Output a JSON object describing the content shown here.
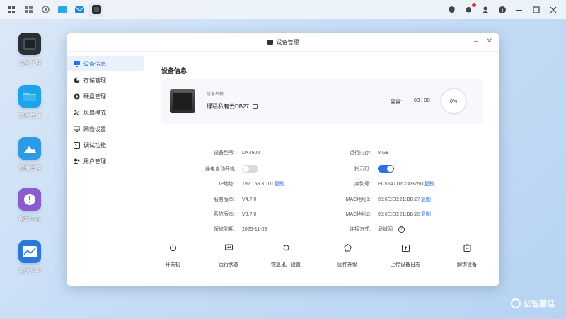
{
  "taskbar": {
    "notification_badge": "1"
  },
  "desktop": {
    "icons": [
      {
        "label": "设备管理",
        "color": "#2a2e35"
      },
      {
        "label": "文件管理",
        "color": "#1fa3e8"
      },
      {
        "label": "相册管理",
        "color": "#2b9be6"
      },
      {
        "label": "帮助中心",
        "color": "#8b5ccf"
      },
      {
        "label": "系统监控",
        "color": "#2a78d8"
      }
    ]
  },
  "window": {
    "title": "设备管理",
    "sidebar": [
      {
        "label": "设备信息",
        "icon": "computer-icon",
        "active": true
      },
      {
        "label": "存储管理",
        "icon": "pie-chart-icon",
        "active": false
      },
      {
        "label": "硬盘管理",
        "icon": "disk-icon",
        "active": false
      },
      {
        "label": "风扇模式",
        "icon": "fan-icon",
        "active": false
      },
      {
        "label": "网络设置",
        "icon": "network-icon",
        "active": false
      },
      {
        "label": "调试功能",
        "icon": "debug-icon",
        "active": false
      },
      {
        "label": "用户管理",
        "icon": "users-icon",
        "active": false
      }
    ],
    "section_title": "设备信息",
    "device": {
      "name_label": "设备名称",
      "name": "绿联私有云DB27",
      "capacity_label": "容量:",
      "capacity_value": "0B / 0B",
      "usage_percent": "0%"
    },
    "info_left": [
      {
        "key": "设备型号:",
        "value": "DX4600"
      },
      {
        "key": "通电自动开机",
        "value": "",
        "toggle": false
      },
      {
        "key": "IP地址:",
        "value": "192.168.3.101",
        "copy": "复制"
      },
      {
        "key": "服务版本:",
        "value": "V4.7.0"
      },
      {
        "key": "系统版本:",
        "value": "V3.7.0"
      },
      {
        "key": "保修到期:",
        "value": "2025-11-09"
      }
    ],
    "info_right": [
      {
        "key": "运行内存:",
        "value": "8 GB"
      },
      {
        "key": "指示灯:",
        "value": "",
        "toggle": true
      },
      {
        "key": "序列号:",
        "value": "EC554JJ16230375D",
        "copy": "复制"
      },
      {
        "key": "MAC地址1:",
        "value": "98:6E:E8:21:DB:27",
        "copy": "复制"
      },
      {
        "key": "MAC地址2:",
        "value": "98:6E:E8:21:DB:28",
        "copy": "复制"
      },
      {
        "key": "连接方式:",
        "value": "局域网"
      }
    ],
    "actions": [
      {
        "label": "开关机",
        "icon": "power-icon"
      },
      {
        "label": "运行状态",
        "icon": "monitor-icon"
      },
      {
        "label": "恢复出厂设置",
        "icon": "reset-icon"
      },
      {
        "label": "固件升级",
        "icon": "upgrade-icon"
      },
      {
        "label": "上传设备日志",
        "icon": "upload-log-icon"
      },
      {
        "label": "解绑设备",
        "icon": "unbind-icon"
      }
    ]
  },
  "watermark": "亿智蘑菇"
}
